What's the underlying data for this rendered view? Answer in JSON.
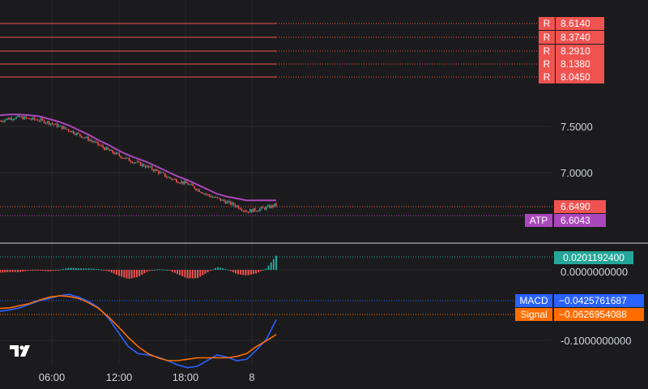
{
  "chart_data": [
    {
      "type": "candlestick",
      "title": "",
      "price_axis_labels": [
        "7.5000",
        "7.0000"
      ],
      "time_axis_labels": [
        "06:00",
        "12:00",
        "18:00",
        "8"
      ],
      "resistance_levels": [
        {
          "tag": "R",
          "value": "8.6140"
        },
        {
          "tag": "R",
          "value": "8.3740"
        },
        {
          "tag": "R",
          "value": "8.2910"
        },
        {
          "tag": "R",
          "value": "8.1380"
        },
        {
          "tag": "R",
          "value": "8.0450"
        }
      ],
      "last_price": "6.6490",
      "atp": {
        "label": "ATP",
        "value": "6.6043"
      },
      "price_series": [
        [
          "00:00",
          7.56
        ],
        [
          "01:00",
          7.59
        ],
        [
          "02:00",
          7.6
        ],
        [
          "03:00",
          7.58
        ],
        [
          "04:00",
          7.57
        ],
        [
          "05:00",
          7.54
        ],
        [
          "06:00",
          7.5
        ],
        [
          "07:00",
          7.46
        ],
        [
          "08:00",
          7.41
        ],
        [
          "09:00",
          7.36
        ],
        [
          "10:00",
          7.3
        ],
        [
          "11:00",
          7.24
        ],
        [
          "12:00",
          7.19
        ],
        [
          "13:00",
          7.14
        ],
        [
          "14:00",
          7.1
        ],
        [
          "15:00",
          7.06
        ],
        [
          "16:00",
          7.01
        ],
        [
          "17:00",
          6.95
        ],
        [
          "18:00",
          6.91
        ],
        [
          "19:00",
          6.88
        ],
        [
          "20:00",
          6.82
        ],
        [
          "21:00",
          6.76
        ],
        [
          "22:00",
          6.72
        ],
        [
          "23:00",
          6.68
        ],
        [
          "00:00",
          6.64
        ],
        [
          "01:00",
          6.58
        ],
        [
          "02:00",
          6.6
        ],
        [
          "03:00",
          6.62
        ],
        [
          "04:00",
          6.65
        ]
      ],
      "atp_series": [
        7.62,
        7.63,
        7.63,
        7.62,
        7.61,
        7.58,
        7.55,
        7.51,
        7.46,
        7.41,
        7.35,
        7.3,
        7.24,
        7.19,
        7.15,
        7.11,
        7.06,
        7.01,
        6.96,
        6.92,
        6.87,
        6.82,
        6.77,
        6.74,
        6.72,
        6.7,
        6.7,
        6.7,
        6.7
      ]
    },
    {
      "type": "macd",
      "axis_labels": [
        "0.0201192400",
        "0.0000000000",
        "-0.1000000000"
      ],
      "histogram_label": "0.0201192400",
      "macd": {
        "label": "MACD",
        "value": "−0.0425761687"
      },
      "signal": {
        "label": "Signal",
        "value": "−0.0626954088"
      },
      "macd_series": [
        -0.03,
        -0.028,
        -0.025,
        -0.02,
        -0.015,
        -0.012,
        -0.008,
        -0.006,
        -0.01,
        -0.016,
        -0.025,
        -0.04,
        -0.06,
        -0.08,
        -0.09,
        -0.092,
        -0.095,
        -0.1,
        -0.106,
        -0.11,
        -0.108,
        -0.1,
        -0.092,
        -0.095,
        -0.1,
        -0.098,
        -0.085,
        -0.07,
        -0.042
      ],
      "signal_series": [
        -0.026,
        -0.025,
        -0.022,
        -0.019,
        -0.014,
        -0.01,
        -0.008,
        -0.009,
        -0.012,
        -0.018,
        -0.026,
        -0.038,
        -0.052,
        -0.067,
        -0.08,
        -0.09,
        -0.096,
        -0.1,
        -0.1,
        -0.098,
        -0.096,
        -0.096,
        -0.096,
        -0.096,
        -0.094,
        -0.09,
        -0.08,
        -0.072,
        -0.063
      ],
      "histogram": [
        -0.004,
        -0.003,
        -0.003,
        -0.001,
        -0.001,
        -0.002,
        0.0,
        0.003,
        0.002,
        0.002,
        0.001,
        -0.002,
        -0.008,
        -0.013,
        -0.01,
        -0.002,
        0.001,
        0.0,
        -0.006,
        -0.012,
        -0.012,
        -0.004,
        0.004,
        0.001,
        -0.006,
        -0.008,
        -0.005,
        0.002,
        0.02
      ]
    }
  ],
  "colors": {
    "up": "#26a69a",
    "down": "#ef5350",
    "atp": "#ab47bc",
    "macd": "#2962ff",
    "signal": "#ff6d00",
    "resistance": "#ef5350",
    "background": "#1b1b1d"
  },
  "logo": "tradingview-logo-icon"
}
